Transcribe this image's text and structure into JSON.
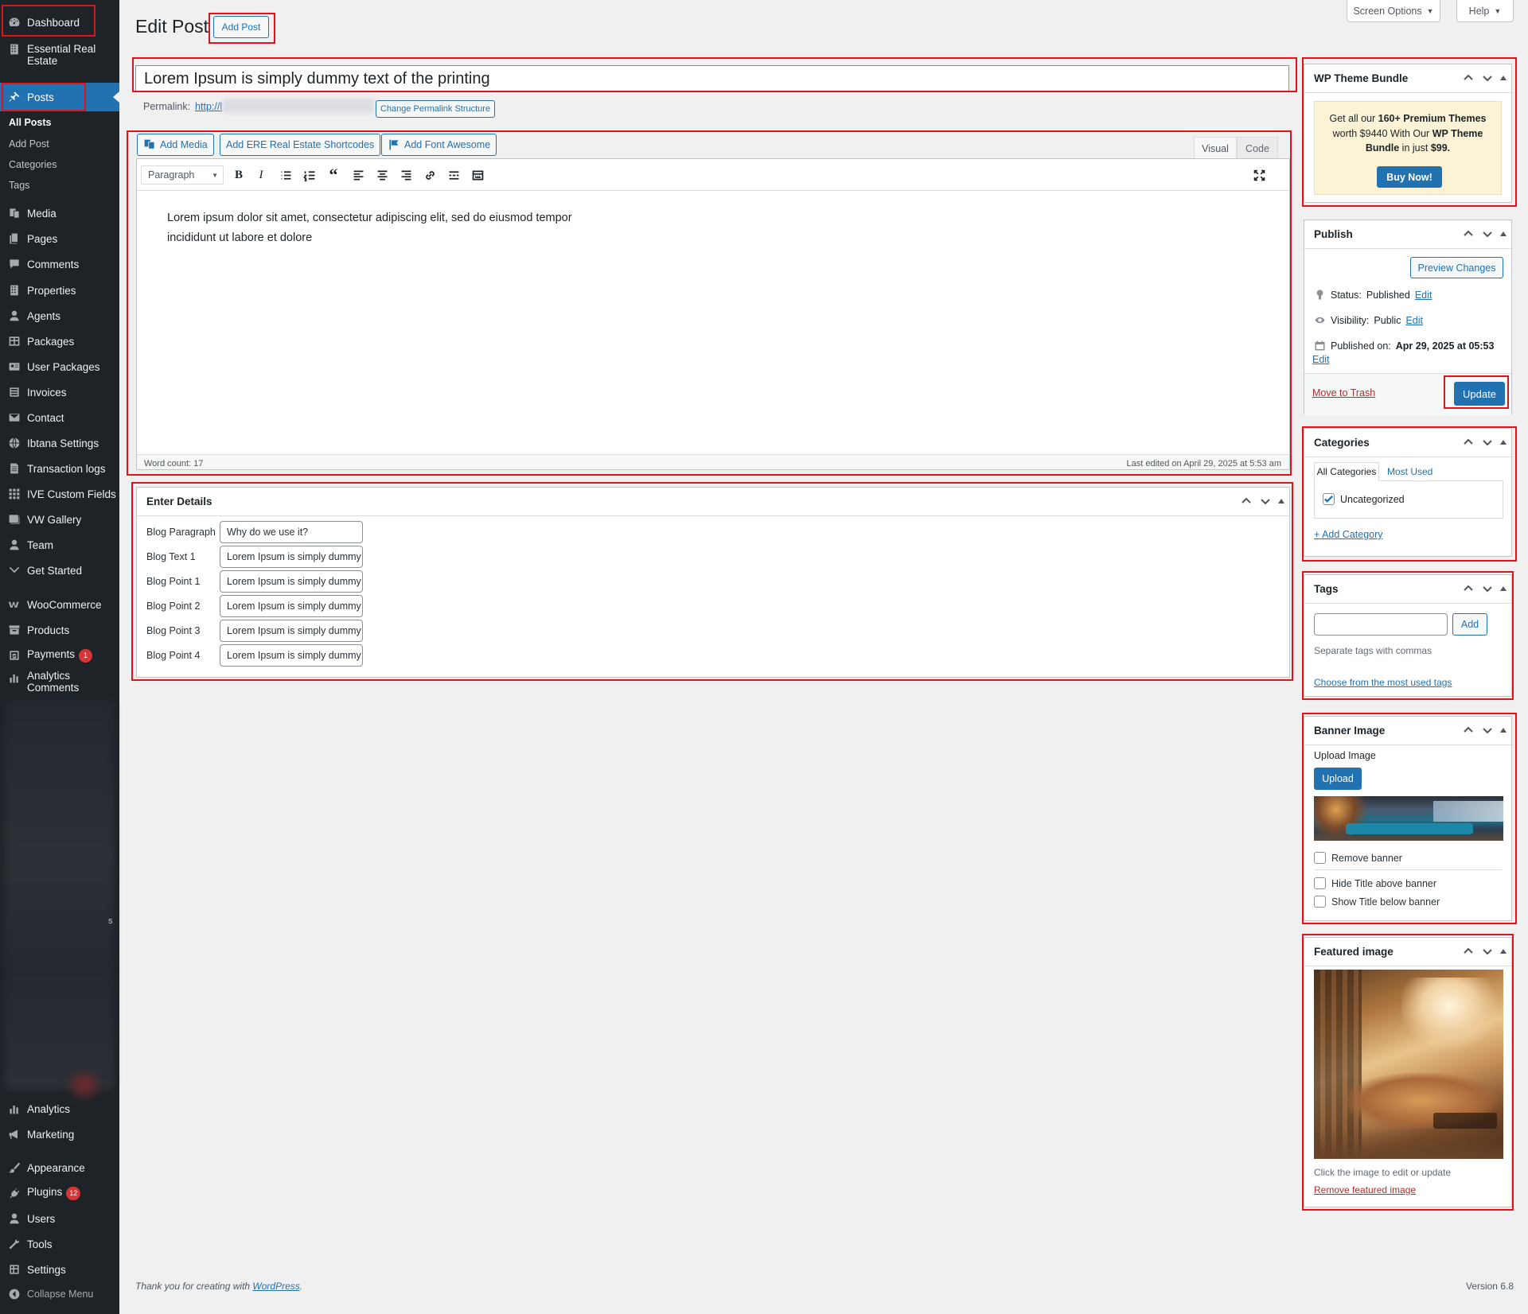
{
  "sidebar": {
    "items": [
      {
        "label": "Dashboard",
        "icon": "dashboard-icon"
      },
      {
        "label": "Essential Real Estate",
        "icon": "building-icon"
      },
      {
        "label": "Posts",
        "icon": "pushpin-icon"
      },
      {
        "label": "Media",
        "icon": "media-icon"
      },
      {
        "label": "Pages",
        "icon": "pages-icon"
      },
      {
        "label": "Comments",
        "icon": "comments-icon"
      },
      {
        "label": "Properties",
        "icon": "building-icon"
      },
      {
        "label": "Agents",
        "icon": "user-icon"
      },
      {
        "label": "Packages",
        "icon": "grid-icon"
      },
      {
        "label": "User Packages",
        "icon": "id-card-icon"
      },
      {
        "label": "Invoices",
        "icon": "list-icon"
      },
      {
        "label": "Contact",
        "icon": "mail-icon"
      },
      {
        "label": "Ibtana Settings",
        "icon": "globe-icon"
      },
      {
        "label": "Transaction logs",
        "icon": "document-icon"
      },
      {
        "label": "IVE Custom Fields",
        "icon": "grid-icon"
      },
      {
        "label": "VW Gallery",
        "icon": "gallery-icon"
      },
      {
        "label": "Team",
        "icon": "user-icon"
      },
      {
        "label": "Get Started",
        "icon": "chevron-down-icon"
      },
      {
        "label": "WooCommerce",
        "icon": "woocommerce-icon"
      },
      {
        "label": "Products",
        "icon": "archive-icon"
      },
      {
        "label": "Payments",
        "icon": "payment-icon",
        "badge": "1"
      },
      {
        "label": "Analytics Comments",
        "icon": "bar-chart-icon"
      },
      {
        "label": "Analytics",
        "icon": "bar-chart-icon"
      },
      {
        "label": "Marketing",
        "icon": "megaphone-icon"
      },
      {
        "label": "Appearance",
        "icon": "brush-icon"
      },
      {
        "label": "Plugins",
        "icon": "plugin-icon",
        "badge": "12"
      },
      {
        "label": "Users",
        "icon": "user-icon"
      },
      {
        "label": "Tools",
        "icon": "wrench-icon"
      },
      {
        "label": "Settings",
        "icon": "settings-icon"
      },
      {
        "label": "Collapse Menu",
        "icon": "collapse-icon"
      }
    ],
    "posts_submenu": [
      "All Posts",
      "Add Post",
      "Categories",
      "Tags"
    ],
    "stray_char": "s"
  },
  "header": {
    "page_title": "Edit Post",
    "add_post_label": "Add Post",
    "screen_options_label": "Screen Options",
    "help_label": "Help"
  },
  "post": {
    "title": "Lorem Ipsum is simply dummy text of the printing",
    "permalink_label": "Permalink:",
    "permalink_url": "http://l",
    "change_permalink_label": "Change Permalink Structure"
  },
  "editor": {
    "add_media_label": "Add Media",
    "ere_shortcodes_label": "Add ERE Real Estate Shortcodes",
    "font_awesome_label": "Add Font Awesome",
    "tab_visual": "Visual",
    "tab_code": "Code",
    "format_select": "Paragraph",
    "content_line1": "Lorem ipsum dolor sit amet, consectetur adipiscing elit, sed do eiusmod tempor",
    "content_line2": "incididunt ut labore et dolore",
    "word_count": "Word count: 17",
    "last_edited": "Last edited on April 29, 2025 at 5:53 am"
  },
  "details": {
    "title": "Enter Details",
    "rows": [
      {
        "label": "Blog Paragraph",
        "value": "Why do we use it?"
      },
      {
        "label": "Blog Text 1",
        "value": "Lorem Ipsum is simply dummy"
      },
      {
        "label": "Blog Point 1",
        "value": "Lorem Ipsum is simply dummy"
      },
      {
        "label": "Blog Point 2",
        "value": "Lorem Ipsum is simply dummy"
      },
      {
        "label": "Blog Point 3",
        "value": "Lorem Ipsum is simply dummy"
      },
      {
        "label": "Blog Point 4",
        "value": "Lorem Ipsum is simply dummy"
      }
    ]
  },
  "theme_bundle": {
    "title": "WP Theme Bundle",
    "text_pre": "Get all our ",
    "text_bold1": "160+ Premium Themes",
    "text_mid": " worth $9440 With Our ",
    "text_bold2": "WP Theme Bundle",
    "text_mid2": " in just ",
    "text_bold3": "$99.",
    "button_label": "Buy Now!"
  },
  "publish": {
    "title": "Publish",
    "preview_label": "Preview Changes",
    "status_label": "Status:",
    "status_value": "Published",
    "visibility_label": "Visibility:",
    "visibility_value": "Public",
    "published_label": "Published on:",
    "published_value": "Apr 29, 2025 at 05:53",
    "edit_label": "Edit",
    "trash_label": "Move to Trash",
    "update_label": "Update"
  },
  "categories": {
    "title": "Categories",
    "tab_all": "All Categories",
    "tab_used": "Most Used",
    "items": [
      {
        "label": "Uncategorized",
        "checked": true
      }
    ],
    "add_label": "+ Add Category"
  },
  "tags": {
    "title": "Tags",
    "add_label": "Add",
    "hint": "Separate tags with commas",
    "choose_label": "Choose from the most used tags"
  },
  "banner": {
    "title": "Banner Image",
    "upload_title": "Upload Image",
    "upload_label": "Upload",
    "remove_label": "Remove banner",
    "hide_label": "Hide Title above banner",
    "show_label": "Show Title below banner"
  },
  "featured": {
    "title": "Featured image",
    "hint": "Click the image to edit or update",
    "remove_label": "Remove featured image"
  },
  "footer": {
    "thanks_pre": "Thank you for creating with ",
    "thanks_link": "WordPress",
    "thanks_post": ".",
    "version": "Version 6.8"
  },
  "colors": {
    "accent": "#2271b1",
    "sidebar": "#1d2327",
    "highlight": "#e0121b",
    "danger": "#d63638"
  }
}
